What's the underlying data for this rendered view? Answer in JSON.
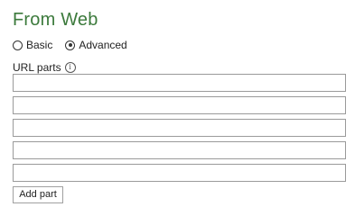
{
  "dialog": {
    "title": "From Web",
    "mode_options": [
      {
        "label": "Basic",
        "selected": false
      },
      {
        "label": "Advanced",
        "selected": true
      }
    ],
    "url_parts": {
      "label": "URL parts",
      "info_icon": "info-icon",
      "inputs": [
        {
          "value": ""
        },
        {
          "value": ""
        },
        {
          "value": ""
        },
        {
          "value": ""
        },
        {
          "value": ""
        }
      ]
    },
    "add_part_label": "Add part"
  },
  "colors": {
    "title": "#3c7a3c",
    "input_border": "#9a9a9a",
    "button_border": "#a0a0a0"
  }
}
